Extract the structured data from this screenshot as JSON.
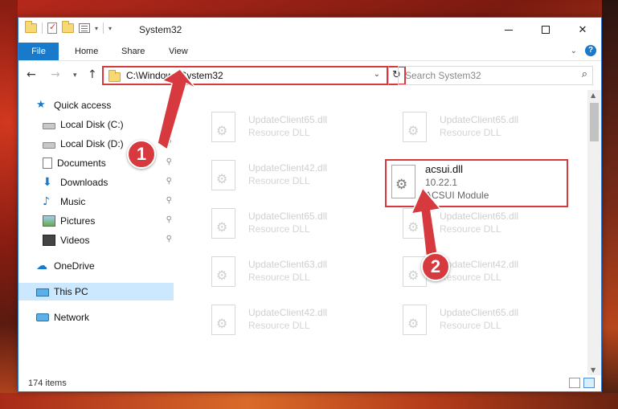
{
  "window": {
    "title": "System32",
    "controls": {
      "minimize": "minimize-icon",
      "maximize": "maximize-icon",
      "close": "✕"
    }
  },
  "ribbon": {
    "tabs": [
      "File",
      "Home",
      "Share",
      "View"
    ],
    "help_label": "?"
  },
  "address": {
    "path": "C:\\Windows\\System32",
    "search_placeholder": "Search System32"
  },
  "sidebar": {
    "items": [
      {
        "label": "Quick access",
        "icon": "star-icon",
        "pinned": false
      },
      {
        "label": "Local Disk (C:)",
        "icon": "drive-icon",
        "pinned": true
      },
      {
        "label": "Local Disk (D:)",
        "icon": "drive-icon",
        "pinned": true
      },
      {
        "label": "Documents",
        "icon": "documents-icon",
        "pinned": true
      },
      {
        "label": "Downloads",
        "icon": "download-icon",
        "pinned": true
      },
      {
        "label": "Music",
        "icon": "music-icon",
        "pinned": true
      },
      {
        "label": "Pictures",
        "icon": "pictures-icon",
        "pinned": true
      },
      {
        "label": "Videos",
        "icon": "videos-icon",
        "pinned": true
      },
      {
        "label": "OneDrive",
        "icon": "cloud-icon",
        "pinned": false
      },
      {
        "label": "This PC",
        "icon": "computer-icon",
        "pinned": false,
        "selected": true
      },
      {
        "label": "Network",
        "icon": "network-icon",
        "pinned": false
      }
    ]
  },
  "files": [
    {
      "name": "UpdateClient65.dll",
      "desc": "Resource DLL"
    },
    {
      "name": "UpdateClient65.dll",
      "desc": "Resource DLL"
    },
    {
      "name": "UpdateClient42.dll",
      "desc": "Resource DLL"
    },
    {
      "name": "UpdateClient65.dll",
      "desc": "Resource DLL"
    },
    {
      "name": "UpdateClient65.dll",
      "desc": "Resource DLL"
    },
    {
      "name": "UpdateClient63.dll",
      "desc": "Resource DLL"
    },
    {
      "name": "UpdateClient42.dll",
      "desc": "Resource DLL"
    },
    {
      "name": "UpdateClient42.dll",
      "desc": "Resource DLL"
    },
    {
      "name": "UpdateClient65.dll",
      "desc": "Resource DLL"
    }
  ],
  "highlighted_file": {
    "name": "acsui.dll",
    "version": "10.22.1",
    "desc": "ACSUI Module"
  },
  "status": {
    "item_count": "174 items"
  },
  "annotations": {
    "badge_1": "1",
    "badge_2": "2",
    "color": "#d63a3f"
  }
}
